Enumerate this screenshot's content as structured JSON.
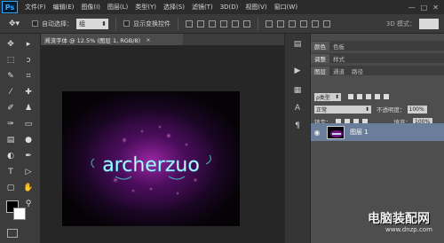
{
  "app": {
    "logo": "Ps"
  },
  "menu": {
    "items": [
      "文件(F)",
      "编辑(E)",
      "图像(I)",
      "图层(L)",
      "类型(Y)",
      "选择(S)",
      "滤镜(T)",
      "3D(D)",
      "视图(V)",
      "窗口(W)"
    ]
  },
  "window_controls": {
    "minimize": "—",
    "restore": "□",
    "close": "✕"
  },
  "options": {
    "auto_select_label": "自动选择：",
    "auto_select_value": "组",
    "show_transform_label": "显示变换控件",
    "mode_3d_label": "3D 模式："
  },
  "document": {
    "tab_title": "溯流字体 @ 12.5% (图层 1, RGB/8)",
    "close": "×",
    "canvas_text": "archerzuo"
  },
  "panels": {
    "tabs_row1": [
      "颜色",
      "色板"
    ],
    "tabs_row2": [
      "调整",
      "样式"
    ],
    "tabs_row3": [
      "图层",
      "通道",
      "路径"
    ],
    "filter_label": "ρ类型",
    "blend_mode": "正常",
    "opacity_label": "不透明度：",
    "opacity_value": "100%",
    "lock_label": "锁定：",
    "fill_label": "填充：",
    "fill_value": "100%",
    "layer_name": "图层 1"
  },
  "watermark": {
    "title": "电脑装配网",
    "url": "www.dnzp.com"
  },
  "colors": {
    "accent": "#31a8ff",
    "selection": "#6a7d9a",
    "canvas_glow": "#8a1c9a",
    "text_glow": "#5ad6ff"
  },
  "icons": {
    "toolbar": [
      "move-icon",
      "marquee-icon",
      "lasso-icon",
      "quick-select-icon",
      "crop-icon",
      "eyedropper-icon",
      "healing-icon",
      "brush-icon",
      "stamp-icon",
      "history-brush-icon",
      "eraser-icon",
      "gradient-icon",
      "blur-icon",
      "dodge-icon",
      "pen-icon",
      "type-icon",
      "path-select-icon",
      "shape-icon",
      "hand-icon",
      "zoom-icon"
    ]
  }
}
